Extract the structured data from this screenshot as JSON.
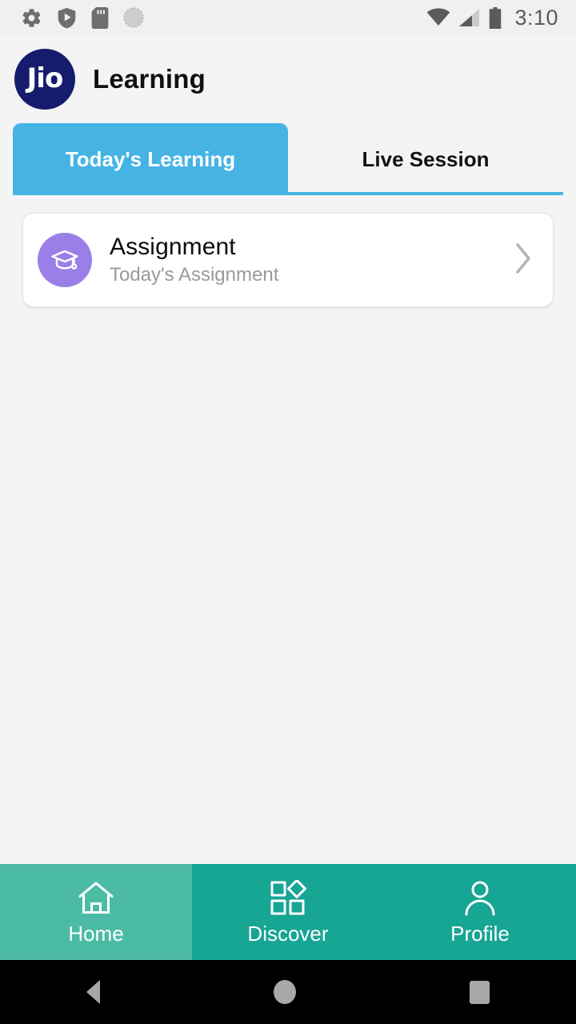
{
  "status_bar": {
    "time": "3:10",
    "left_icons": [
      "gear-icon",
      "play-protect-shield-icon",
      "sd-card-icon",
      "sync-circle-icon"
    ],
    "right_icons": [
      "wifi-icon",
      "cellular-signal-icon",
      "battery-icon"
    ],
    "icon_color": "#6e6e6e",
    "background": "#f0f0f0"
  },
  "app_bar": {
    "logo_text": "Jio",
    "logo_color": "#151c6e",
    "title": "Learning"
  },
  "tabs": {
    "accent_color": "#45b4e5",
    "items": [
      {
        "label": "Today's Learning",
        "active": true
      },
      {
        "label": "Live Session",
        "active": false
      }
    ]
  },
  "content": {
    "cards": [
      {
        "title": "Assignment",
        "subtitle": "Today's Assignment",
        "avatar_icon": "graduation-cap-icon",
        "avatar_color": "#9b7fe8",
        "chevron_icon": "chevron-right-icon"
      }
    ]
  },
  "bottom_nav": {
    "background": "#17a594",
    "active_background": "#4cbba5",
    "items": [
      {
        "label": "Home",
        "icon": "home-icon",
        "active": true
      },
      {
        "label": "Discover",
        "icon": "grid-diamond-icon",
        "active": false
      },
      {
        "label": "Profile",
        "icon": "person-icon",
        "active": false
      }
    ]
  },
  "system_nav": {
    "background": "#000000",
    "buttons": [
      {
        "name": "back-button",
        "icon": "triangle-left-icon"
      },
      {
        "name": "home-button",
        "icon": "circle-icon"
      },
      {
        "name": "recents-button",
        "icon": "square-icon"
      }
    ]
  }
}
